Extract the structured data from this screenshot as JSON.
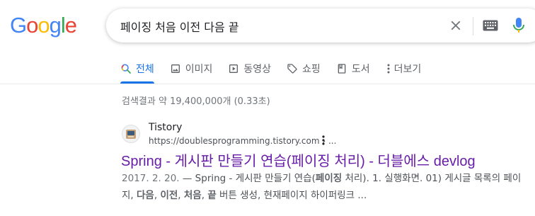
{
  "logo": {
    "letters": [
      "G",
      "o",
      "o",
      "g",
      "l",
      "e"
    ],
    "colors": [
      "#4285F4",
      "#EA4335",
      "#FBBC05",
      "#4285F4",
      "#34A853",
      "#EA4335"
    ]
  },
  "search": {
    "query": "페이징 처음 이전 다음 끝",
    "clear_icon": "close-icon",
    "keyboard_icon": "keyboard-icon",
    "mic_icon": "microphone-icon"
  },
  "tabs": [
    {
      "label": "전체",
      "icon": "search-icon",
      "active": true
    },
    {
      "label": "이미지",
      "icon": "image-icon",
      "active": false
    },
    {
      "label": "동영상",
      "icon": "video-icon",
      "active": false
    },
    {
      "label": "쇼핑",
      "icon": "tag-icon",
      "active": false
    },
    {
      "label": "도서",
      "icon": "book-icon",
      "active": false
    },
    {
      "label": "더보기",
      "icon": "more-vert-icon",
      "active": false
    }
  ],
  "stats": "검색결과 약 19,400,000개 (0.33초)",
  "result": {
    "site_name": "Tistory",
    "url": "https://doublesprogramming.tistory.com › ...",
    "title": "Spring - 게시판 만들기 연습(페이징 처리) - 더블에스 devlog",
    "snippet_line1_date": "2017. 2. 20.",
    "snippet_line1_a": " — Spring - 게시판 만들기 연습(",
    "snippet_line1_bold": "페이징",
    "snippet_line1_b": " 처리). 1. 실행화면. 01) 게시글 목록의 페이",
    "snippet_line2_a": "지, ",
    "snippet_line2_b1": "다음",
    "snippet_line2_c": ", ",
    "snippet_line2_b2": "이전",
    "snippet_line2_d": ", ",
    "snippet_line2_b3": "처음",
    "snippet_line2_e": ", ",
    "snippet_line2_b4": "끝",
    "snippet_line2_f": " 버튼 생성, 현재페이지 하이퍼링크 ..."
  }
}
